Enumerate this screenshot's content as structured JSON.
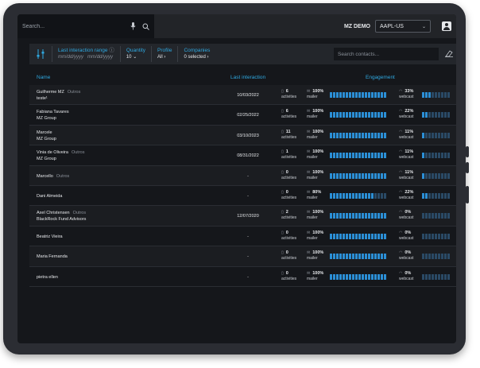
{
  "topbar": {
    "search_placeholder": "Search...",
    "mic_icon": "microphone-icon",
    "search_icon": "search-icon",
    "company": "MZ DEMO",
    "ticker": "AAPL-US",
    "profile_icon": "profile-icon"
  },
  "filters": {
    "range_label": "Last interaction range",
    "range_from": "mm/dd/yyyy",
    "range_to": "mm/dd/yyyy",
    "quantity_label": "Quantity",
    "quantity_value": "10",
    "profile_label": "Profile",
    "profile_value": "All",
    "companies_label": "Companies",
    "companies_value": "0 selected",
    "contacts_placeholder": "Search contacts..."
  },
  "columns": {
    "name": "Name",
    "last_interaction": "Last interaction",
    "engagement": "Engagement"
  },
  "rows": [
    {
      "name": "Guilherme MZ",
      "tag": "Outros",
      "sub": "teste¹",
      "date": "10/03/2022",
      "activities": "6",
      "mailer_pct": "100%",
      "mailer_fill": 1.0,
      "webcast_pct": "33%",
      "webcast_fill": 0.33
    },
    {
      "name": "Fabiana Tavares",
      "tag": "",
      "sub": "MZ Group",
      "date": "02/25/2022",
      "activities": "6",
      "mailer_pct": "100%",
      "mailer_fill": 1.0,
      "webcast_pct": "22%",
      "webcast_fill": 0.22
    },
    {
      "name": "Marcele",
      "tag": "",
      "sub": "MZ Group",
      "date": "03/10/2023",
      "activities": "11",
      "mailer_pct": "100%",
      "mailer_fill": 1.0,
      "webcast_pct": "11%",
      "webcast_fill": 0.11
    },
    {
      "name": "Vinia de Oliveira",
      "tag": "Outros",
      "sub": "MZ Group",
      "date": "08/31/2022",
      "activities": "1",
      "mailer_pct": "100%",
      "mailer_fill": 1.0,
      "webcast_pct": "11%",
      "webcast_fill": 0.11
    },
    {
      "name": "Marcello",
      "tag": "Outros",
      "sub": "",
      "date": "-",
      "activities": "0",
      "mailer_pct": "100%",
      "mailer_fill": 1.0,
      "webcast_pct": "11%",
      "webcast_fill": 0.11
    },
    {
      "name": "Dani Almeida",
      "tag": "",
      "sub": "",
      "date": "-",
      "activities": "0",
      "mailer_pct": "80%",
      "mailer_fill": 0.8,
      "webcast_pct": "22%",
      "webcast_fill": 0.22
    },
    {
      "name": "Axel Christensen",
      "tag": "Outros",
      "sub": "BlackRock Fund Advisors",
      "date": "12/07/2020",
      "activities": "2",
      "mailer_pct": "100%",
      "mailer_fill": 1.0,
      "webcast_pct": "0%",
      "webcast_fill": 0.0
    },
    {
      "name": "Beatriz Vieira",
      "tag": "",
      "sub": "",
      "date": "-",
      "activities": "0",
      "mailer_pct": "100%",
      "mailer_fill": 1.0,
      "webcast_pct": "0%",
      "webcast_fill": 0.0
    },
    {
      "name": "Maria Fernanda",
      "tag": "",
      "sub": "",
      "date": "-",
      "activities": "0",
      "mailer_pct": "100%",
      "mailer_fill": 1.0,
      "webcast_pct": "0%",
      "webcast_fill": 0.0
    },
    {
      "name": "pietra ellen",
      "tag": "",
      "sub": "",
      "date": "-",
      "activities": "0",
      "mailer_pct": "100%",
      "mailer_fill": 1.0,
      "webcast_pct": "0%",
      "webcast_fill": 0.0
    }
  ],
  "labels": {
    "activities": "activities",
    "mailer": "mailer",
    "webcast": "webcast"
  },
  "colors": {
    "accent": "#2fa8e0",
    "bar_on": "#2b8fd6",
    "bar_off": "#2a4a66"
  }
}
